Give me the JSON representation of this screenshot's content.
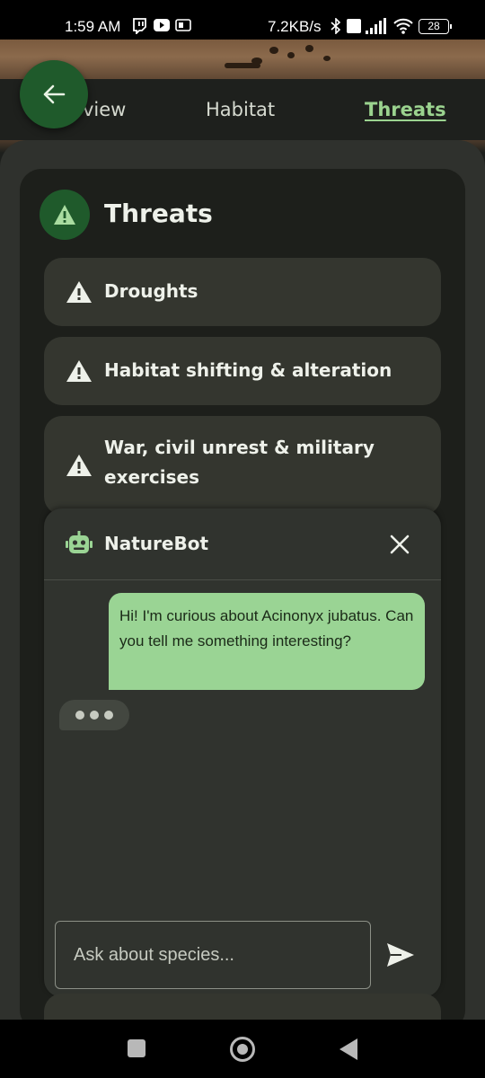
{
  "status_bar": {
    "time": "1:59 AM",
    "network_speed": "7.2KB/s",
    "battery": "28"
  },
  "tabs": [
    {
      "label": "view",
      "active": false
    },
    {
      "label": "Habitat",
      "active": false
    },
    {
      "label": "Threats",
      "active": true
    }
  ],
  "section": {
    "title": "Threats",
    "items": [
      {
        "label": "Droughts"
      },
      {
        "label": "Habitat shifting & alteration"
      },
      {
        "label": "War, civil unrest & military exercises"
      }
    ]
  },
  "chat": {
    "bot_name": "NatureBot",
    "messages": [
      {
        "from": "user",
        "text": "Hi! I'm curious about Acinonyx jubatus. Can you tell me something interesting?"
      }
    ],
    "typing": true,
    "input_placeholder": "Ask about species...",
    "input_value": ""
  },
  "colors": {
    "accent_green": "#9bd38f",
    "fab_green": "#1f5a2b",
    "user_bubble": "#9ad494"
  }
}
